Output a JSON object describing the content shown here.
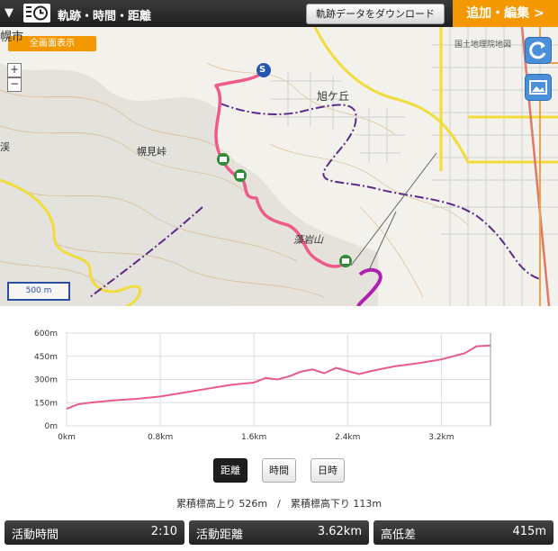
{
  "header": {
    "title": "軌跡・時間・距離",
    "download_label": "軌跡データをダウンロード",
    "edit_label": "追加・編集 >"
  },
  "map": {
    "fullscreen_label": "全画面表示",
    "zoom_in": "+",
    "zoom_out": "−",
    "scale_label": "500 m",
    "attribution": "国土地理院地図",
    "labels": {
      "asahigaoka": "旭ケ丘",
      "horomi_pass": "幌見峠",
      "moiwa": "藻岩山",
      "city": "幌市",
      "kei": "渓"
    },
    "start_marker": "S"
  },
  "chart_data": {
    "type": "line",
    "title": "",
    "xlabel": "",
    "ylabel": "",
    "x_ticks": [
      "0km",
      "0.8km",
      "1.6km",
      "2.4km",
      "3.2km"
    ],
    "y_ticks": [
      "0m",
      "150m",
      "300m",
      "450m",
      "600m"
    ],
    "xlim": [
      0,
      3.62
    ],
    "ylim": [
      0,
      600
    ],
    "grid": true,
    "series": [
      {
        "color": "#e85a8a",
        "x": [
          0,
          0.1,
          0.2,
          0.4,
          0.6,
          0.8,
          1.0,
          1.2,
          1.4,
          1.6,
          1.7,
          1.8,
          1.9,
          2.0,
          2.1,
          2.2,
          2.3,
          2.4,
          2.5,
          2.6,
          2.8,
          3.0,
          3.2,
          3.4,
          3.5,
          3.62
        ],
        "y": [
          110,
          140,
          150,
          165,
          175,
          190,
          215,
          240,
          265,
          280,
          310,
          300,
          320,
          350,
          365,
          340,
          375,
          355,
          335,
          355,
          385,
          405,
          430,
          470,
          515,
          520
        ]
      }
    ]
  },
  "tabs": [
    {
      "label": "距離",
      "active": true
    },
    {
      "label": "時間",
      "active": false
    },
    {
      "label": "日時",
      "active": false
    }
  ],
  "summary": "累積標高上り 526m　/　累積標高下り 113m",
  "stats": [
    {
      "label": "活動時間",
      "value": "2:10"
    },
    {
      "label": "活動距離",
      "value": "3.62km"
    },
    {
      "label": "高低差",
      "value": "415m"
    }
  ]
}
